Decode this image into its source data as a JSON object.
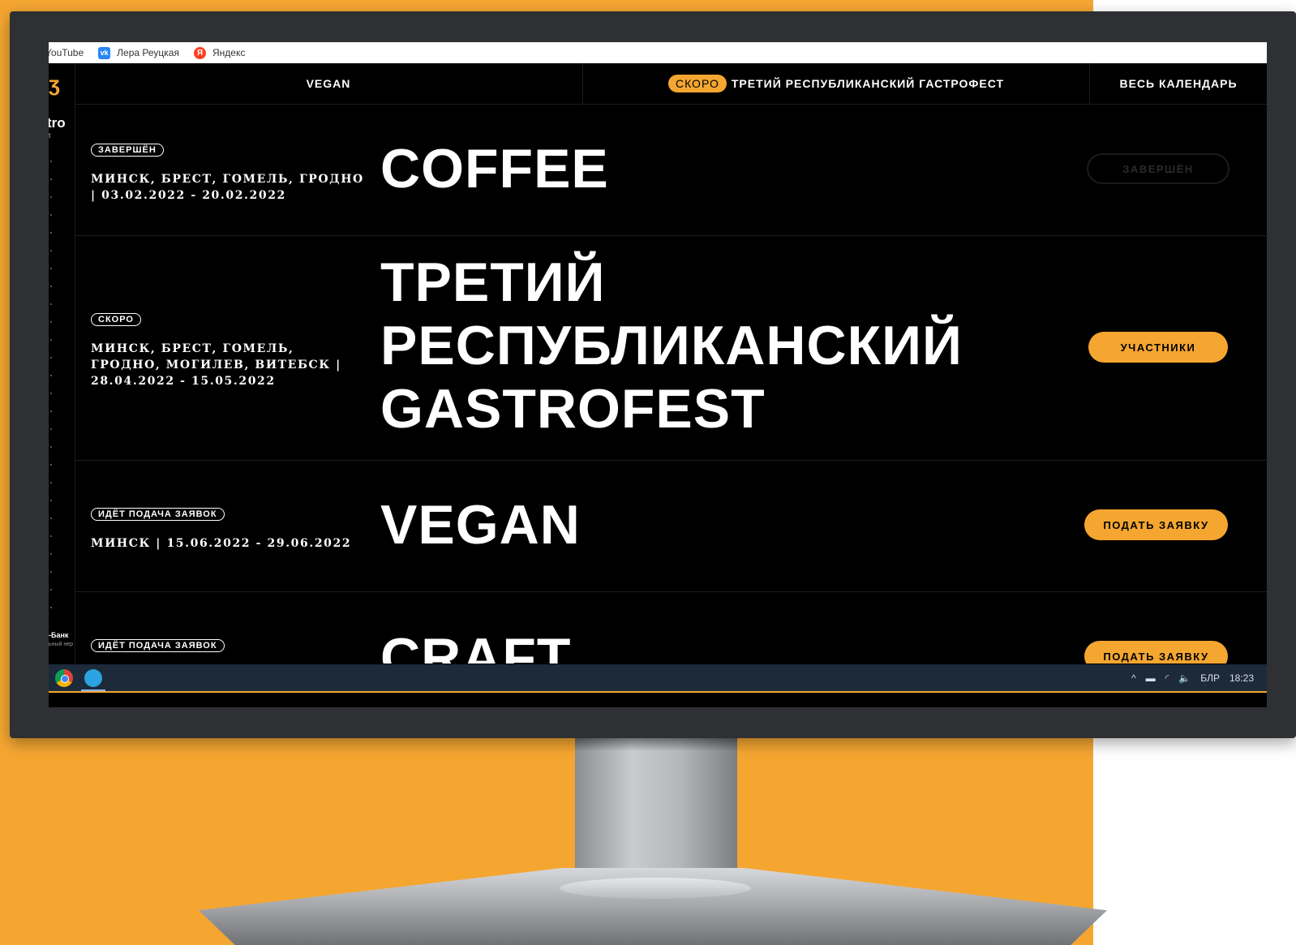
{
  "bookmarks": [
    {
      "label": "YouTube",
      "icon": "youtube-icon"
    },
    {
      "label": "Лера Реуцкая",
      "icon": "vk-icon",
      "icon_text": "vk"
    },
    {
      "label": "Яндекс",
      "icon": "yandex-icon",
      "icon_text": "Я"
    }
  ],
  "sidebar": {
    "logo_text": "tro",
    "logo_sub": "t",
    "bank_label": "-Банк",
    "bank_sub": "ьный\nнер"
  },
  "nav": {
    "vegan": "VEGAN",
    "soon_pill": "СКОРО",
    "soon_title": "ТРЕТИЙ РЕСПУБЛИКАНСКИЙ ГАСТРОФЕСТ",
    "calendar": "ВЕСЬ КАЛЕНДАРЬ"
  },
  "events": [
    {
      "status": "ЗАВЕРШЁН",
      "location": "МИНСК, БРЕСТ, ГОМЕЛЬ, ГРОДНО | 03.02.2022 - 20.02.2022",
      "title": "COFFEE",
      "action": "ЗАВЕРШЁН"
    },
    {
      "status": "СКОРО",
      "location": "МИНСК, БРЕСТ, ГОМЕЛЬ, ГРОДНО, МОГИЛЕВ, ВИТЕБСК | 28.04.2022 - 15.05.2022",
      "title_lines": [
        "ТРЕТИЙ",
        "РЕСПУБЛИКАНСКИЙ",
        "GASTROFEST"
      ],
      "action": "УЧАСТНИКИ"
    },
    {
      "status": "ИДЁТ ПОДАЧА ЗАЯВОК",
      "location": "МИНСК | 15.06.2022 - 29.06.2022",
      "title": "VEGAN",
      "action": "ПОДАТЬ ЗАЯВКУ"
    },
    {
      "status": "ИДЁТ ПОДАЧА ЗАЯВОК",
      "title": "CRAFT",
      "action": "ПОДАТЬ ЗАЯВКУ"
    }
  ],
  "taskbar": {
    "tray_caret": "^",
    "lang": "БЛР",
    "time": "18:23"
  },
  "colors": {
    "accent": "#F4A631",
    "screen_bg": "#000000",
    "bezel": "#2e3033"
  }
}
